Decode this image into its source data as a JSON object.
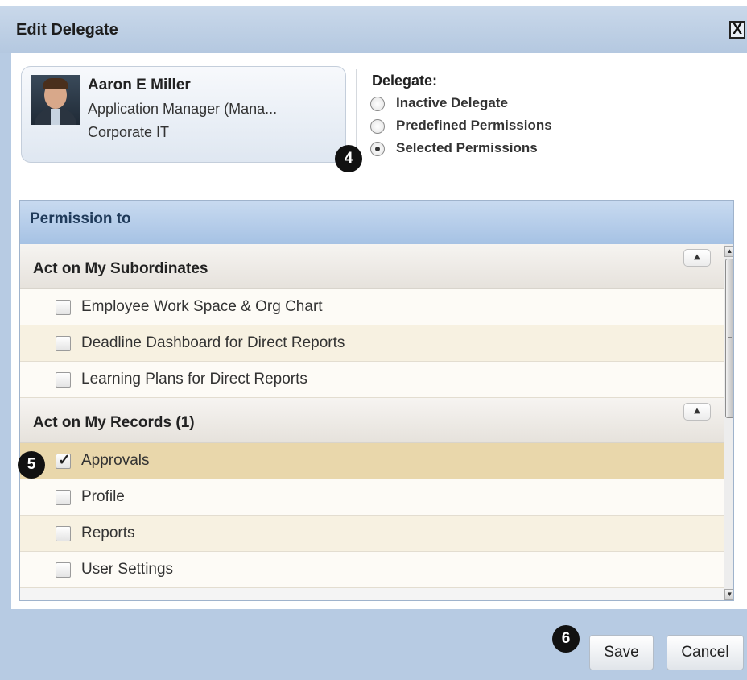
{
  "dialog": {
    "title": "Edit Delegate",
    "close_label": "X"
  },
  "user": {
    "name": "Aaron E Miller",
    "title": "Application Manager (Mana...",
    "department": "Corporate IT"
  },
  "delegate": {
    "label": "Delegate:",
    "options": [
      {
        "label": "Inactive Delegate",
        "selected": false
      },
      {
        "label": "Predefined Permissions",
        "selected": false
      },
      {
        "label": "Selected Permissions",
        "selected": true
      }
    ]
  },
  "permissions": {
    "header": "Permission to",
    "collapse_icon": "double-chevron-up-icon",
    "sections": [
      {
        "title": "Act on My Subordinates",
        "items": [
          {
            "label": "Employee Work Space & Org Chart",
            "checked": false
          },
          {
            "label": "Deadline Dashboard for Direct Reports",
            "checked": false
          },
          {
            "label": "Learning Plans for Direct Reports",
            "checked": false
          }
        ]
      },
      {
        "title": "Act on My Records (1)",
        "items": [
          {
            "label": "Approvals",
            "checked": true
          },
          {
            "label": "Profile",
            "checked": false
          },
          {
            "label": "Reports",
            "checked": false
          },
          {
            "label": "User Settings",
            "checked": false
          }
        ]
      }
    ]
  },
  "buttons": {
    "save": "Save",
    "cancel": "Cancel"
  },
  "callouts": {
    "delegate_option": "4",
    "approvals": "5",
    "save": "6"
  }
}
